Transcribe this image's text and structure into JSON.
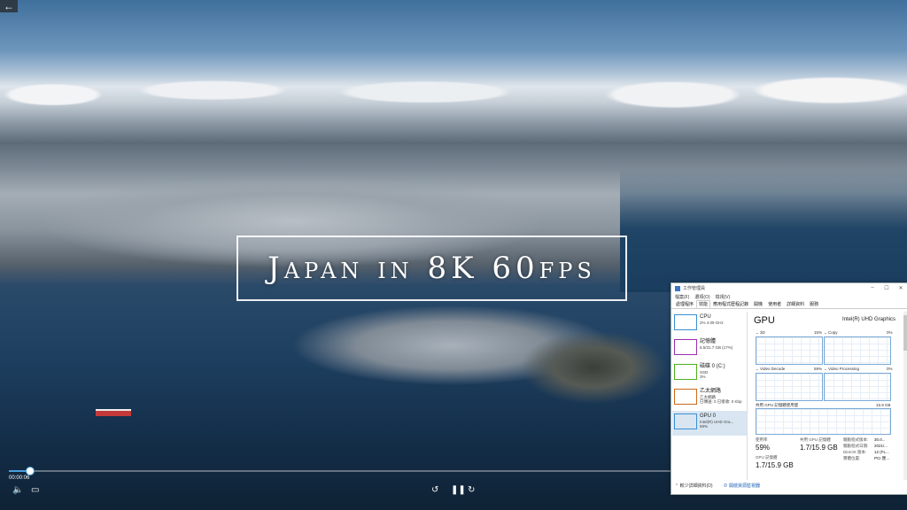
{
  "video": {
    "title_overlay": "Japan in 8K 60fps",
    "time": "00:00:06",
    "progress_fraction": 0.03,
    "accent": "#4a9fe0"
  },
  "controls": {
    "back_icon": "back-arrow-icon",
    "volume_icon": "volume-icon",
    "caption_icon": "captions-icon",
    "rewind_icon": "rewind-10-icon",
    "pause_icon": "pause-icon",
    "forward_icon": "forward-30-icon"
  },
  "task_manager": {
    "window_title": "工作管理員",
    "menu": [
      "檔案(F)",
      "選項(O)",
      "檢視(V)"
    ],
    "tabs": [
      "處理程序",
      "效能",
      "應用程式歷程記錄",
      "開機",
      "使用者",
      "詳細資料",
      "服務"
    ],
    "active_tab": 1,
    "side_items": [
      {
        "name": "CPU",
        "sub": "2% 4.09 GHz",
        "color": "#3c8fd1"
      },
      {
        "name": "記憶體",
        "sub": "5.5/31.7 GB (17%)",
        "color": "#9b2fae"
      },
      {
        "name": "磁碟 0 (C:)",
        "sub": "SSD",
        "sub2": "3%",
        "color": "#4caf23"
      },
      {
        "name": "乙太網路",
        "sub": "乙太網路",
        "sub2": "已傳送: 0 已接收: 0 Kbp",
        "color": "#c96a1f"
      },
      {
        "name": "GPU 0",
        "sub": "Intel(R) UHD Gra...",
        "sub2": "59%",
        "color": "#3c8fd1"
      }
    ],
    "gpu": {
      "heading": "GPU",
      "model": "Intel(R) UHD Graphics",
      "graph_labels": [
        "3D",
        "15%",
        "Copy",
        "0%",
        "Video Decode",
        "59%",
        "Video Processing",
        "0%"
      ],
      "shared_label": "共用 GPU 記憶體使用量",
      "shared_max": "15.9 GB",
      "usage_label": "使用率",
      "usage_value": "59%",
      "shared_mem_label": "共用 GPU 記憶體",
      "shared_mem_value": "1.7/15.9 GB",
      "gpu_mem_label": "GPU 記憶體",
      "gpu_mem_value": "1.7/15.9 GB",
      "right_labels": [
        "驅動程式版本:",
        "驅動程式日期:",
        "DirectX 版本:",
        "實體位置:"
      ],
      "right_values": [
        "30.0...",
        "2021/...",
        "12 (FL...",
        "PCI 匯..."
      ]
    },
    "footer": {
      "fewer_details": "較少詳細資料(D)",
      "open_monitor": "開啟資源監視器"
    }
  }
}
